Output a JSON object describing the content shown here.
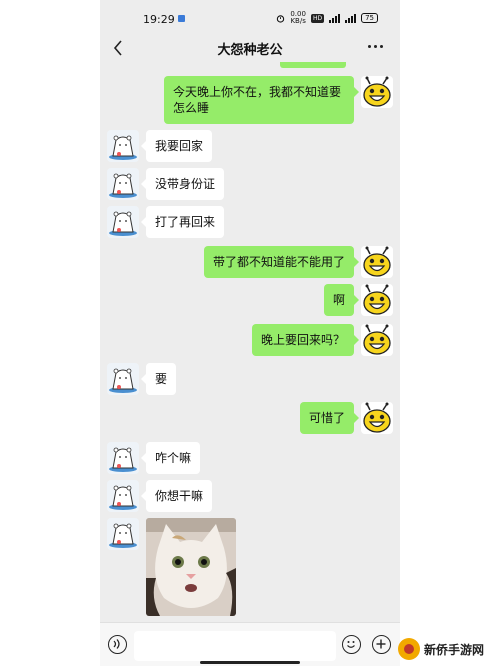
{
  "status_bar": {
    "time": "19:29",
    "speed_value": "0.00",
    "speed_unit": "KB/s",
    "hd_badge": "HD",
    "battery": "75"
  },
  "header": {
    "title": "大怨种老公",
    "back_icon": "chevron-left-icon",
    "more_icon": "more-dots-icon"
  },
  "messages": [
    {
      "from": "me",
      "text": "今天晚上你不在，我都不知道要怎么睡"
    },
    {
      "from": "other",
      "text": "我要回家"
    },
    {
      "from": "other",
      "text": "没带身份证"
    },
    {
      "from": "other",
      "text": "打了再回来"
    },
    {
      "from": "me",
      "text": "带了都不知道能不能用了"
    },
    {
      "from": "me",
      "text": "啊"
    },
    {
      "from": "me",
      "text": "晚上要回来吗？"
    },
    {
      "from": "other",
      "text": "要"
    },
    {
      "from": "me",
      "text": "可惜了"
    },
    {
      "from": "other",
      "text": "咋个嘛"
    },
    {
      "from": "other",
      "text": "你想干嘛"
    },
    {
      "from": "other",
      "type": "image",
      "description": "cat-sticker-photo"
    }
  ],
  "input_bar": {
    "voice_icon": "voice-icon",
    "emoji_icon": "emoji-icon",
    "plus_icon": "plus-icon"
  },
  "watermark": {
    "text": "新侨手游网"
  },
  "colors": {
    "bubble_out": "#95ec69",
    "bubble_in": "#ffffff",
    "chat_bg": "#ededed"
  }
}
